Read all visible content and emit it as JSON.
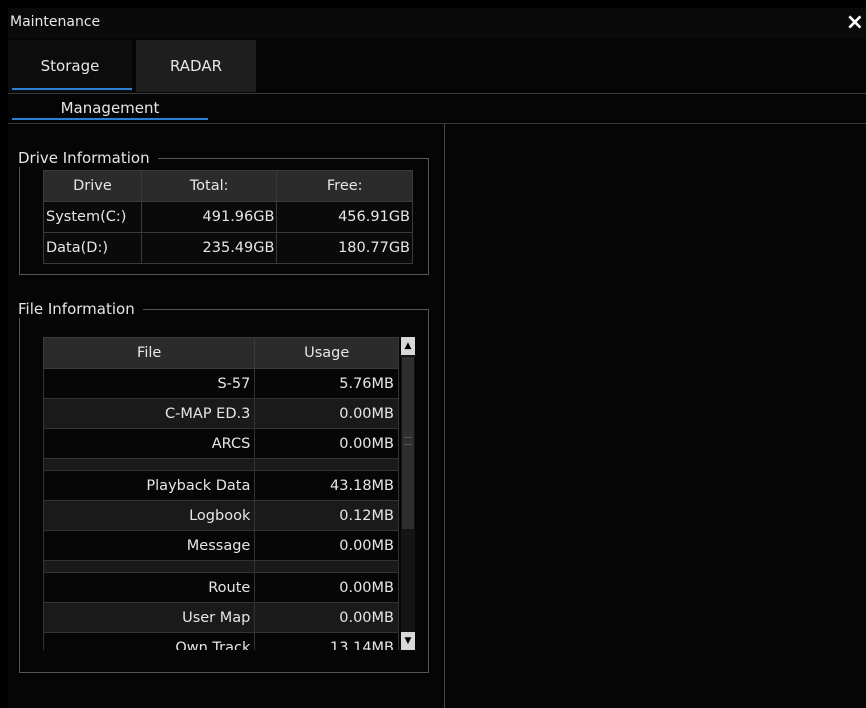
{
  "window": {
    "title": "Maintenance",
    "close_icon": "×"
  },
  "tabs": [
    {
      "label": "Storage"
    },
    {
      "label": "RADAR"
    }
  ],
  "subtab": {
    "label": "Management"
  },
  "drive_info": {
    "legend": "Drive Information",
    "headers": [
      "Drive",
      "Total:",
      "Free:"
    ],
    "rows": [
      {
        "drive": "System(C:)",
        "total": "491.96GB",
        "free": "456.91GB"
      },
      {
        "drive": "Data(D:)",
        "total": "235.49GB",
        "free": "180.77GB"
      }
    ]
  },
  "file_info": {
    "legend": "File Information",
    "headers": [
      "File",
      "Usage"
    ],
    "rows": [
      {
        "file": "S-57",
        "usage": "5.76MB"
      },
      {
        "file": "C-MAP ED.3",
        "usage": "0.00MB"
      },
      {
        "file": "ARCS",
        "usage": "0.00MB"
      },
      {
        "file": "",
        "usage": ""
      },
      {
        "file": "Playback Data",
        "usage": "43.18MB"
      },
      {
        "file": "Logbook",
        "usage": "0.12MB"
      },
      {
        "file": "Message",
        "usage": "0.00MB"
      },
      {
        "file": "",
        "usage": ""
      },
      {
        "file": "Route",
        "usage": "0.00MB"
      },
      {
        "file": "User Map",
        "usage": "0.00MB"
      },
      {
        "file": "Own Track",
        "usage": "13.14MB"
      }
    ]
  },
  "colors": {
    "accent": "#2c7fd6",
    "background": "#050505",
    "header_bg": "#2b2b2b"
  }
}
